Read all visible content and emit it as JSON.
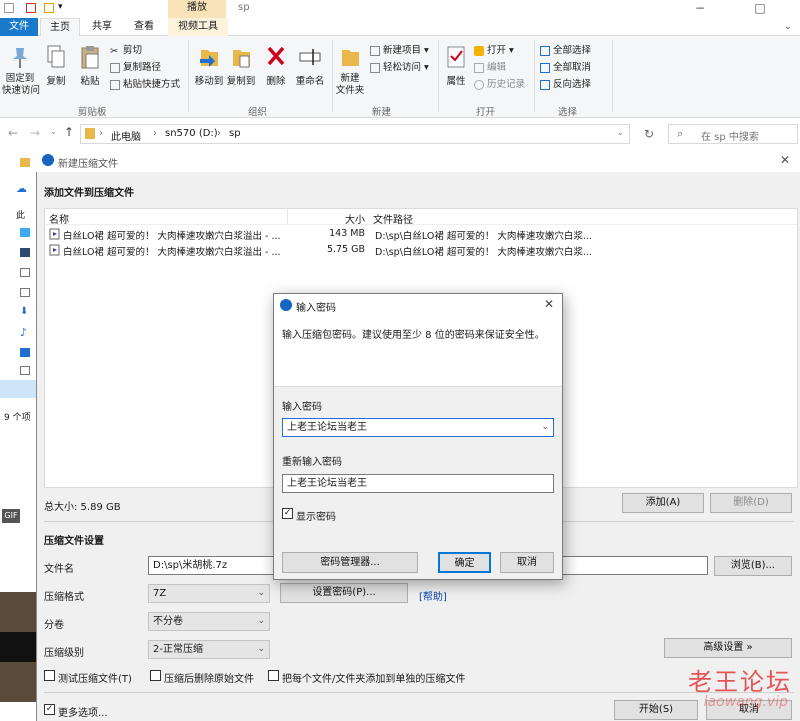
{
  "explorer": {
    "title": "sp",
    "context_tab": "播放",
    "tabs": [
      "文件",
      "主页",
      "共享",
      "查看",
      "视频工具"
    ],
    "ribbon": {
      "clipboard": {
        "pin": "固定到\n快速访问",
        "copy": "复制",
        "paste": "粘贴",
        "cut": "剪切",
        "copy_path": "复制路径",
        "paste_shortcut": "粘贴快捷方式",
        "group": "剪贴板"
      },
      "organize": {
        "move_to": "移动到",
        "copy_to": "复制到",
        "delete": "删除",
        "rename": "重命名",
        "group": "组织"
      },
      "new": {
        "new_folder": "新建\n文件夹",
        "new_item": "新建项目",
        "easy_access": "轻松访问",
        "group": "新建"
      },
      "open": {
        "properties": "属性",
        "open": "打开",
        "edit": "编辑",
        "history": "历史记录",
        "group": "打开"
      },
      "select": {
        "select_all": "全部选择",
        "select_none": "全部取消",
        "invert": "反向选择",
        "group": "选择"
      }
    },
    "address": {
      "path": [
        "此电脑",
        "sn570 (D:)",
        "sp"
      ],
      "search_placeholder": "在 sp 中搜索"
    },
    "status_items": "9 个项",
    "nav_partial": "此"
  },
  "archive_dialog": {
    "title": "新建压缩文件",
    "header": "添加文件到压缩文件",
    "columns": {
      "name": "名称",
      "size": "大小",
      "path": "文件路径"
    },
    "files": [
      {
        "name": "白丝LO裙 超可爱的！ 大肉棒速攻嫩穴白浆溢出 - ...",
        "size": "143 MB",
        "path": "D:\\sp\\白丝LO裙 超可爱的！ 大肉棒速攻嫩穴白浆..."
      },
      {
        "name": "白丝LO裙 超可爱的！ 大肉棒速攻嫩穴白浆溢出 - ...",
        "size": "5.75 GB",
        "path": "D:\\sp\\白丝LO裙 超可爱的！ 大肉棒速攻嫩穴白浆..."
      }
    ],
    "total_size": "总大小: 5.89 GB",
    "add_button": "添加(A)",
    "delete_button": "删除(D)",
    "settings_header": "压缩文件设置",
    "filename_label": "文件名",
    "filename_value": "D:\\sp\\米胡桃.7z",
    "browse_button": "浏览(B)...",
    "format_label": "压缩格式",
    "format_value": "7Z",
    "set_password_button": "设置密码(P)...",
    "help_link": "[帮助]",
    "volume_label": "分卷",
    "volume_value": "不分卷",
    "level_label": "压缩级别",
    "level_value": "2-正常压缩",
    "advanced_button": "高级设置 »",
    "test_checkbox": "测试压缩文件(T)",
    "delete_after_checkbox": "压缩后删除原始文件",
    "separate_checkbox": "把每个文件/文件夹添加到单独的压缩文件",
    "more_options": "更多选项...",
    "start_button": "开始(S)",
    "cancel_button": "取消"
  },
  "password_dialog": {
    "title": "输入密码",
    "description": "输入压缩包密码。建议使用至少 8 位的密码来保证安全性。",
    "password_label": "输入密码",
    "password_value": "上老王论坛当老王",
    "reenter_label": "重新输入密码",
    "reenter_value": "上老王论坛当老王",
    "show_password": "显示密码",
    "show_password_checked": true,
    "manager_button": "密码管理器...",
    "ok_button": "确定",
    "cancel_button": "取消"
  },
  "watermark": {
    "text": "老王论坛",
    "url": "laowang.vip"
  },
  "overlay": {
    "gif_badge": "GIF"
  },
  "colors": {
    "accent": "#1979ca",
    "link": "#0645ad",
    "watermark": "#e23b3b"
  }
}
